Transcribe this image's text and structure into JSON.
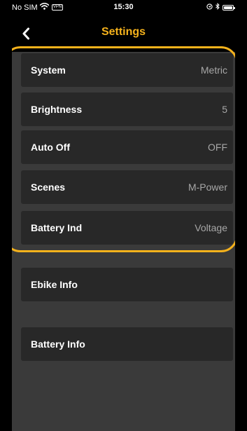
{
  "status_bar": {
    "carrier": "No SIM",
    "vpn": "VPN",
    "time": "15:30"
  },
  "nav": {
    "title": "Settings"
  },
  "settings": [
    {
      "label": "System",
      "value": "Metric"
    },
    {
      "label": "Brightness",
      "value": "5"
    },
    {
      "label": "Auto Off",
      "value": "OFF"
    },
    {
      "label": "Scenes",
      "value": "M-Power"
    },
    {
      "label": "Battery Ind",
      "value": "Voltage"
    }
  ],
  "info": [
    {
      "label": "Ebike Info"
    },
    {
      "label": "Battery Info"
    }
  ],
  "colors": {
    "accent": "#f5b21c",
    "background": "#3a3a3a",
    "row_background": "#282828",
    "bar_background": "#000000",
    "value_text": "#a7a7a7"
  },
  "icons": {
    "back": "chevron-left-icon",
    "wifi": "wifi-icon",
    "location": "location-icon",
    "bluetooth": "bluetooth-icon",
    "battery": "battery-icon"
  }
}
